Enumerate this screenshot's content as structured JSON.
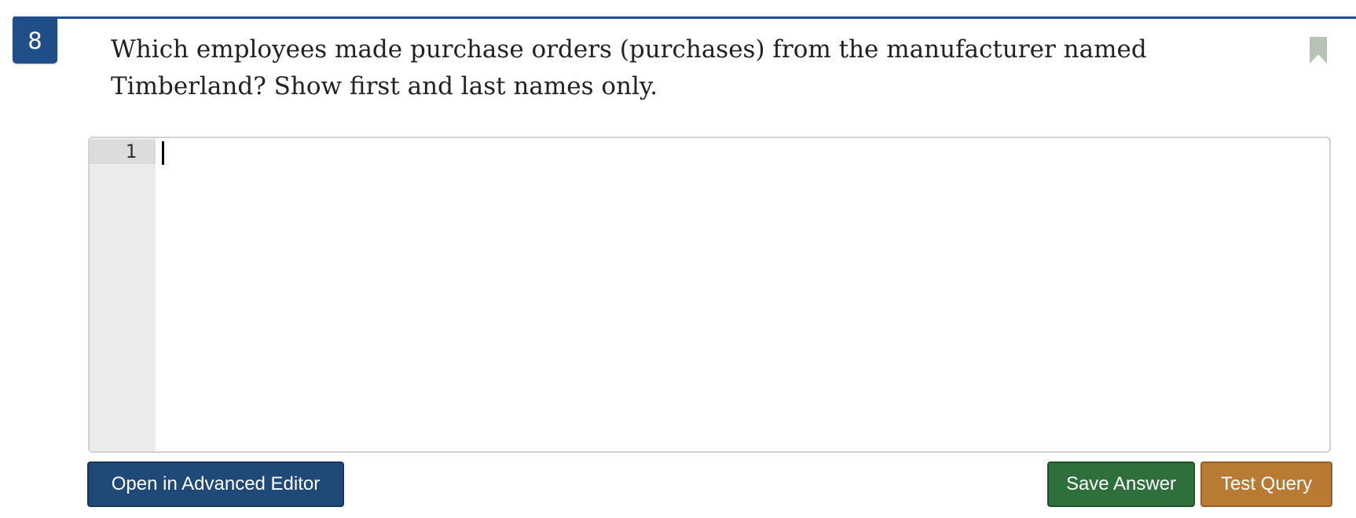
{
  "question": {
    "number": "8",
    "text": "Which employees made purchase orders (purchases) from the manufacturer named Timberland? Show first and last names only."
  },
  "editor": {
    "line_numbers": [
      "1"
    ],
    "content": ""
  },
  "buttons": {
    "advanced_editor": "Open in Advanced Editor",
    "save_answer": "Save Answer",
    "test_query": "Test Query"
  },
  "colors": {
    "primary": "#1f4e89",
    "save": "#2e6f3b",
    "test": "#b97a34",
    "bookmark": "#b8c3b6"
  },
  "icons": {
    "bookmark": "bookmark-icon"
  }
}
